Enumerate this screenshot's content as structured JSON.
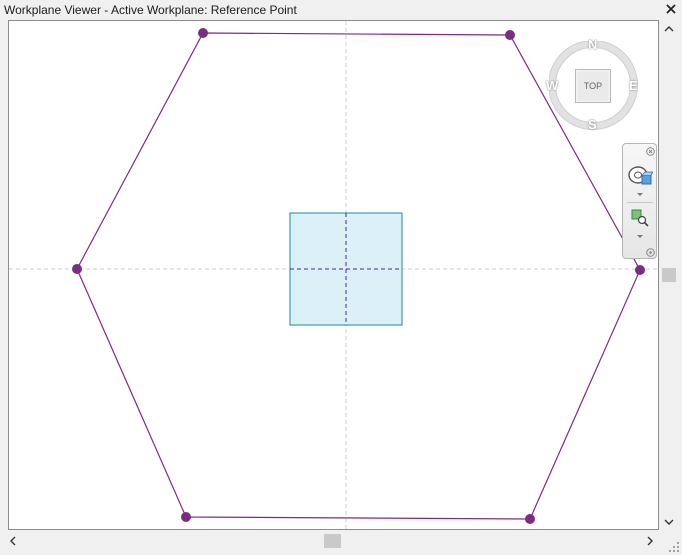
{
  "window": {
    "title": "Workplane Viewer - Active Workplane: Reference Point"
  },
  "viewcube": {
    "top_label": "TOP",
    "compass": {
      "north": "N",
      "south": "S",
      "east": "E",
      "west": "W"
    }
  },
  "icons": {
    "close": "close-icon",
    "scroll_up": "chevron-up-icon",
    "scroll_down": "chevron-down-icon",
    "scroll_left": "chevron-left-icon",
    "scroll_right": "chevron-right-icon",
    "full_navigation_wheel": "steering-wheel-icon",
    "zoom": "zoom-icon",
    "resize": "resize-grip-icon"
  },
  "colors": {
    "hexagon": "#7b2c83",
    "reference_plane_fill": "#dcf0f8",
    "reference_plane_stroke": "#1a8aa0"
  }
}
